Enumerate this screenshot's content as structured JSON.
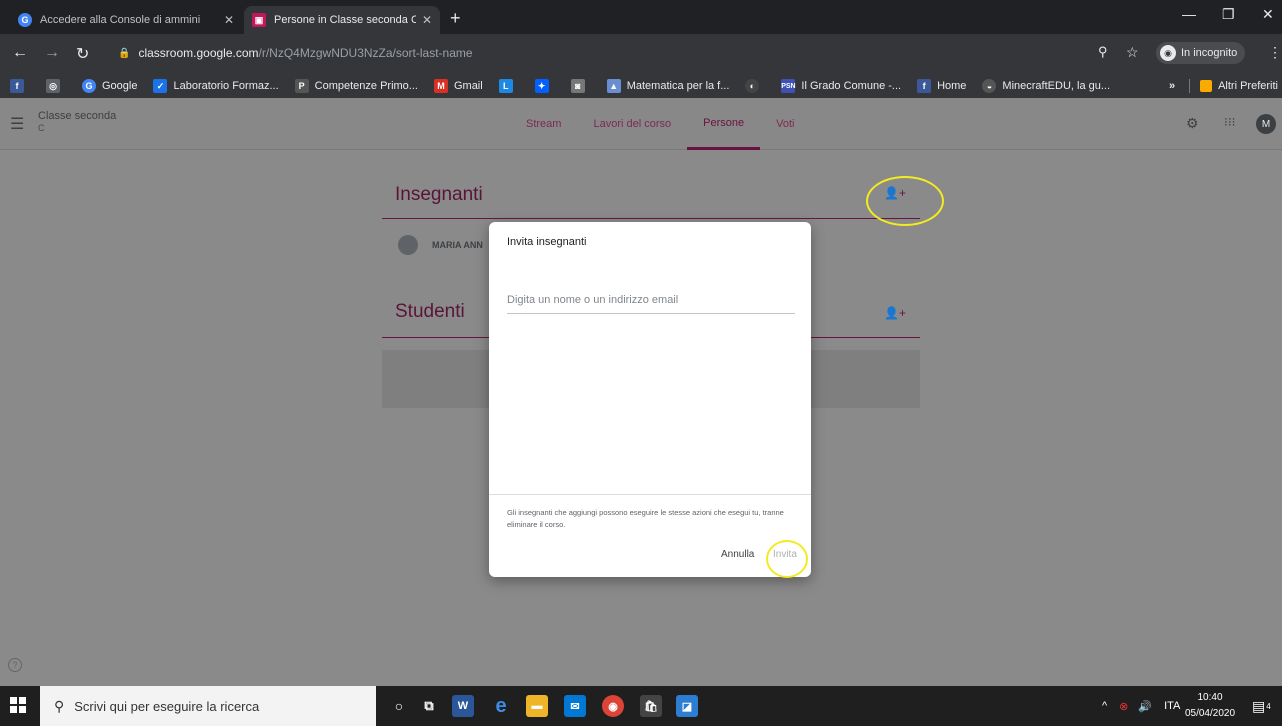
{
  "browser": {
    "tabs": [
      {
        "title": "Accedere alla Console di ammini",
        "active": false
      },
      {
        "title": "Persone in Classe seconda C",
        "active": true
      }
    ],
    "url_host": "classroom.google.com",
    "url_path": "/r/NzQ4MzgwNDU3NzZa/sort-last-name",
    "incognito_label": "In incognito",
    "bookmarks": [
      {
        "label": "",
        "icon": "facebook-icon"
      },
      {
        "label": "",
        "icon": "app-icon"
      },
      {
        "label": "Google",
        "icon": "google-icon"
      },
      {
        "label": "Laboratorio Formaz...",
        "icon": "check-icon"
      },
      {
        "label": "Competenze Primo...",
        "icon": "p-icon"
      },
      {
        "label": "Gmail",
        "icon": "gmail-icon"
      },
      {
        "label": "",
        "icon": "l-icon"
      },
      {
        "label": "",
        "icon": "dropbox-icon"
      },
      {
        "label": "",
        "icon": "camera-icon"
      },
      {
        "label": "Matematica per la f...",
        "icon": "geogebra-icon"
      },
      {
        "label": "",
        "icon": "globe-icon"
      },
      {
        "label": "Il Grado Comune -...",
        "icon": "psn-icon"
      },
      {
        "label": "Home",
        "icon": "facebook-icon"
      },
      {
        "label": "MinecraftEDU, la gu...",
        "icon": "minecraft-icon"
      }
    ],
    "bookmarks_more": "»",
    "other_bookmarks": "Altri Preferiti"
  },
  "classroom": {
    "class_name": "Classe seconda",
    "class_section": "C",
    "tabs": [
      "Stream",
      "Lavori del corso",
      "Persone",
      "Voti"
    ],
    "active_tab": "Persone",
    "teachers_heading": "Insegnanti",
    "teacher_name": "MARIA ANN",
    "students_heading": "Studenti",
    "avatar_letter": "M"
  },
  "dialog": {
    "title": "Invita insegnanti",
    "input_placeholder": "Digita un nome o un indirizzo email",
    "note": "Gli insegnanti che aggiungi possono eseguire le stesse azioni che esegui tu, tranne eliminare il corso.",
    "cancel_label": "Annulla",
    "invite_label": "Invita"
  },
  "taskbar": {
    "search_placeholder": "Scrivi qui per eseguire la ricerca",
    "language": "ITA",
    "time": "10:40",
    "date": "05/04/2020",
    "notification_count": "4"
  },
  "colors": {
    "accent": "#6b1340",
    "highlight": "#f3ea21"
  }
}
